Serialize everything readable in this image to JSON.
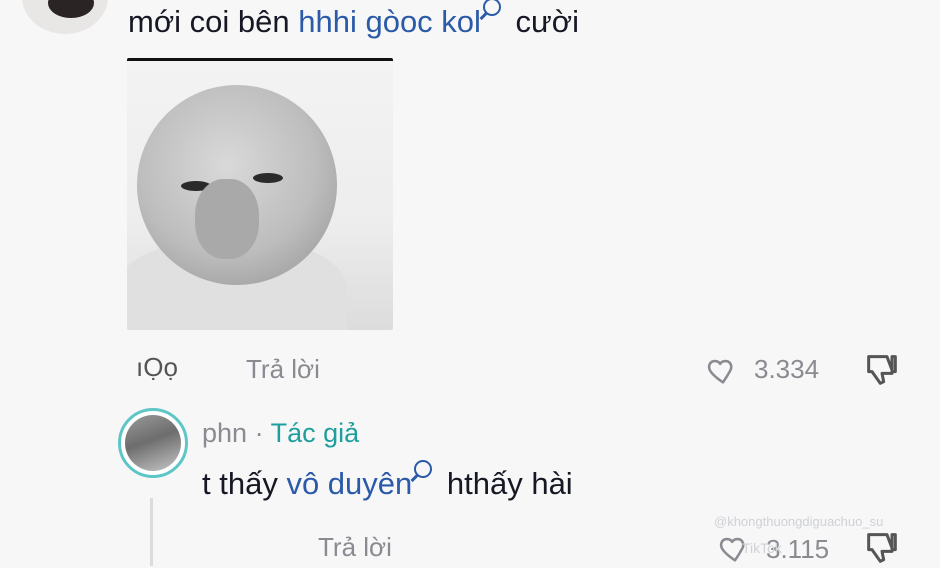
{
  "comment1": {
    "text_before": "mới coi bên ",
    "keyword": "hhhi gòoc kol",
    "text_after": " cười",
    "more_indicator": "ıỌọ",
    "reply_label": "Trả lời",
    "like_count": "3.334"
  },
  "reply": {
    "name": "phn",
    "separator": " · ",
    "author_tag": "Tác giả",
    "text_before": "t thấy ",
    "keyword": "vô duyên",
    "text_after": " hthấy hài",
    "reply_label": "Trả lời",
    "like_count": "3.115"
  },
  "watermark": {
    "handle": "@khongthuongdiguachuo_su",
    "brand": "TikTok"
  },
  "icons": {
    "search": "search-icon",
    "like": "heart-outline-icon",
    "dislike": "thumbs-down-icon"
  },
  "colors": {
    "keyword": "#2b5aa8",
    "author_tag": "#1f9e9e",
    "secondary_text": "#8a8b91",
    "avatar_ring": "#5ec6c6"
  }
}
